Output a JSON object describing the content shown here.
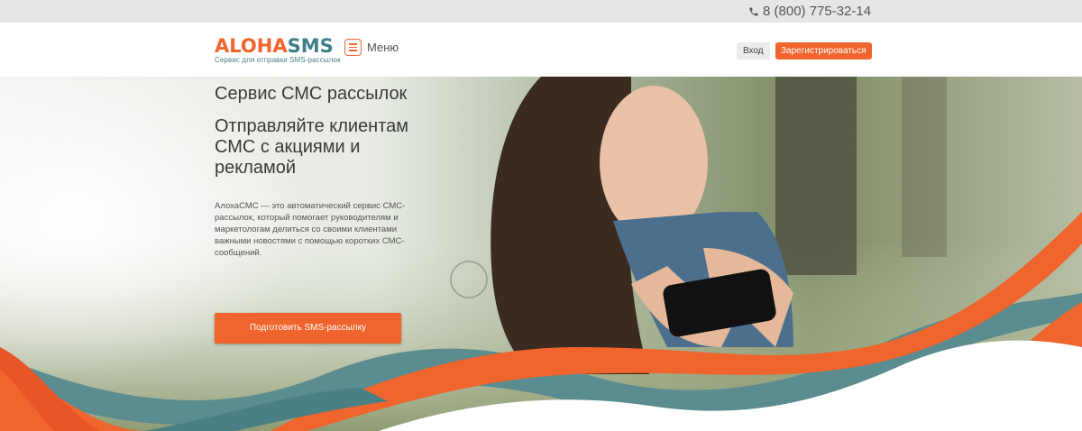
{
  "topbar": {
    "phone": "8 (800) 775-32-14",
    "phone_icon": "phone-icon"
  },
  "header": {
    "logo": {
      "part1": "ALOHA",
      "part2": "SMS",
      "tagline": "Сервис для отправки SMS-рассылок"
    },
    "menu_label": "Меню",
    "menu_icon": "hamburger-icon",
    "login_label": "Вход",
    "register_label": "Зарегистрироваться"
  },
  "hero": {
    "title": "Сервис СМС рассылок",
    "subtitle": "Отправляйте клиентам СМС с акциями и рекламой",
    "description": "АлохаСМС — это автоматический сервис СМС-рассылок, который помогает руководителям и маркетологам делиться со своими клиентами важными новостями с помощью коротких СМС-сообщений.",
    "cta_label": "Подготовить SMS-рассылку",
    "image": "woman-with-phone-photo"
  },
  "colors": {
    "accent": "#f0642d",
    "teal": "#3f7f8a",
    "topbar": "#e6e6e6"
  }
}
